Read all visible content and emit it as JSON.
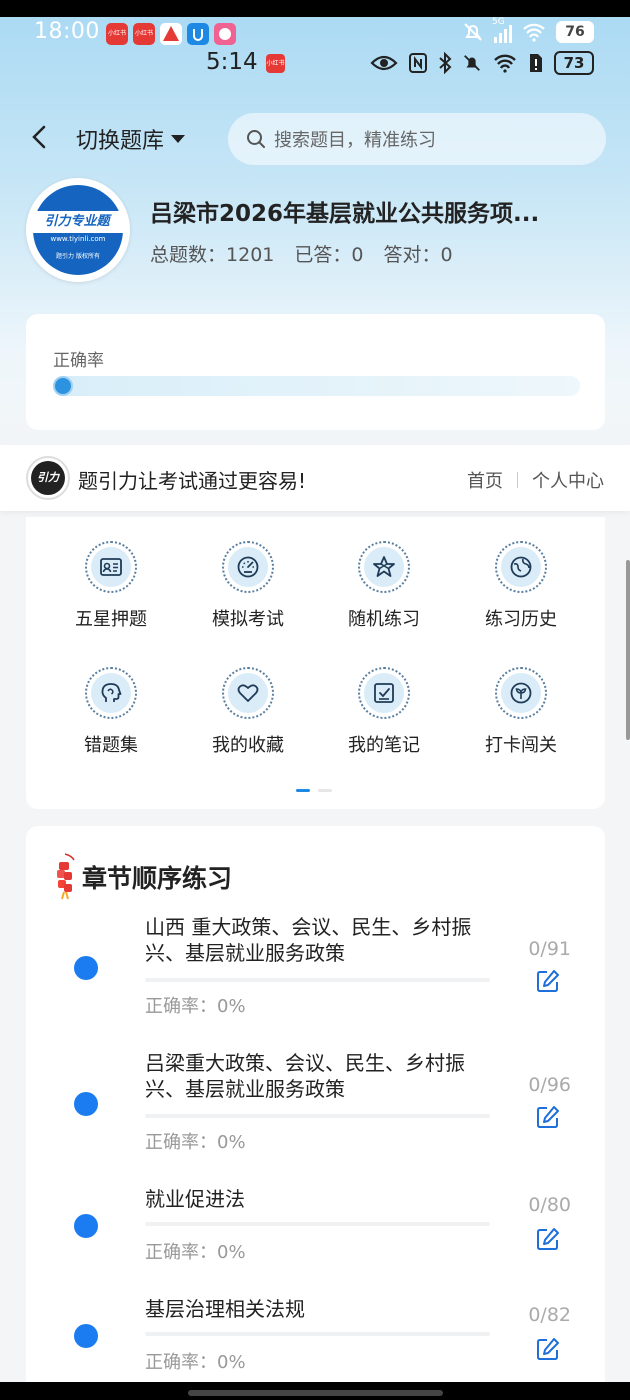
{
  "status_bar_outer": {
    "time": "18:00",
    "app_icons": [
      "小红书",
      "小红书",
      "",
      "",
      ""
    ],
    "signal_label": "5G",
    "battery": "76"
  },
  "status_bar_inner": {
    "time": "5:14",
    "app_icon": "小红书",
    "battery": "73"
  },
  "header": {
    "switch_label": "切换题库",
    "search_placeholder": "搜索题目，精准练习"
  },
  "bank": {
    "logo_text": "引力专业题",
    "logo_url": "www.tiyinli.com",
    "logo_sub": "题引力 版权所有",
    "title": "吕梁市2026年基层就业公共服务项...",
    "total_label": "总题数：",
    "total": "1201",
    "answered_label": "已答：",
    "answered": "0",
    "correct_label": "答对：",
    "correct": "0"
  },
  "accuracy": {
    "label": "正确率",
    "value_fraction": 0
  },
  "brand": {
    "logo_text": "引力",
    "slogan": "题引力让考试通过更容易!",
    "home_link": "首页",
    "profile_link": "个人中心"
  },
  "menu": {
    "items": [
      {
        "label": "五星押题",
        "icon": "id-card-icon"
      },
      {
        "label": "模拟考试",
        "icon": "gauge-icon"
      },
      {
        "label": "随机练习",
        "icon": "star-network-icon"
      },
      {
        "label": "练习历史",
        "icon": "globe-icon"
      },
      {
        "label": "错题集",
        "icon": "head-icon"
      },
      {
        "label": "我的收藏",
        "icon": "heart-icon"
      },
      {
        "label": "我的笔记",
        "icon": "note-check-icon"
      },
      {
        "label": "打卡闯关",
        "icon": "sprout-icon"
      }
    ],
    "pages": 2,
    "active_page": 0
  },
  "chapters": {
    "title": "章节顺序练习",
    "items": [
      {
        "name": "山西 重大政策、会议、民生、乡村振兴、基层就业服务政策",
        "accuracy": "正确率：0%",
        "count": "0/91"
      },
      {
        "name": "吕梁重大政策、会议、民生、乡村振兴、基层就业服务政策",
        "accuracy": "正确率：0%",
        "count": "0/96"
      },
      {
        "name": "就业促进法",
        "accuracy": "正确率：0%",
        "count": "0/80"
      },
      {
        "name": "基层治理相关法规",
        "accuracy": "正确率：0%",
        "count": "0/82"
      }
    ]
  },
  "colors": {
    "accent": "#1a7cf0",
    "header_gradient_top": "#a9d9f3",
    "page_bg": "#f4f5f7"
  }
}
